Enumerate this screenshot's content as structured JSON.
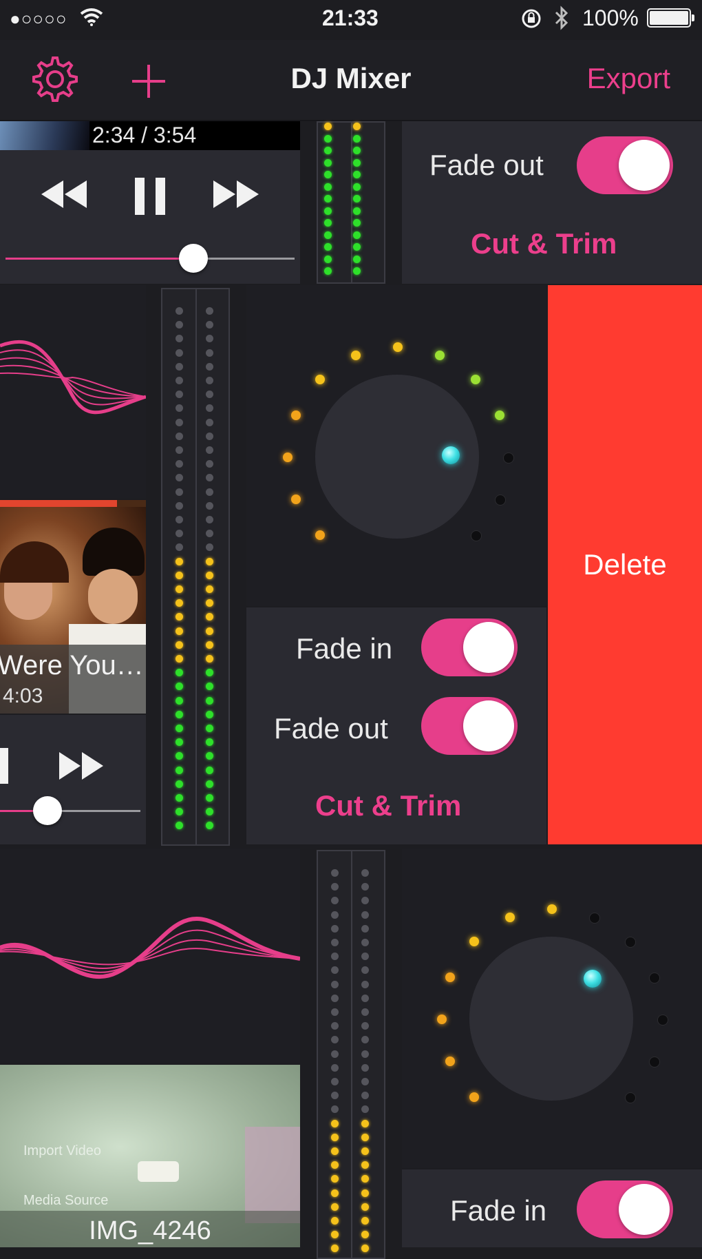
{
  "status_bar": {
    "signal": "●○○○○",
    "time": "21:33",
    "battery": "100%",
    "icons": [
      "wifi-icon",
      "rotation-lock-icon",
      "bluetooth-icon",
      "battery-icon"
    ]
  },
  "navbar": {
    "title": "DJ Mixer",
    "export_label": "Export",
    "settings_icon": "gear-icon",
    "add_icon": "plus-icon"
  },
  "colors": {
    "accent": "#ec3f8c",
    "delete": "#ff3b30",
    "background": "#1d1d21",
    "panel": "#2a2a31"
  },
  "tracks": [
    {
      "time_display": "2:34 / 3:54",
      "seek_progress": 0.65,
      "fade_out_label": "Fade out",
      "fade_out_on": true,
      "cut_trim_label": "Cut & Trim"
    },
    {
      "title": "Were You…",
      "duration": "4:03",
      "seek_progress": 0.34,
      "fade_in_label": "Fade in",
      "fade_in_on": true,
      "fade_out_label": "Fade out",
      "fade_out_on": true,
      "cut_trim_label": "Cut & Trim",
      "delete_label": "Delete"
    },
    {
      "filename": "IMG_4246",
      "fade_in_label": "Fade in",
      "fade_in_on": true,
      "thumbnail_text": [
        "Import Video",
        "Media Source"
      ]
    }
  ]
}
